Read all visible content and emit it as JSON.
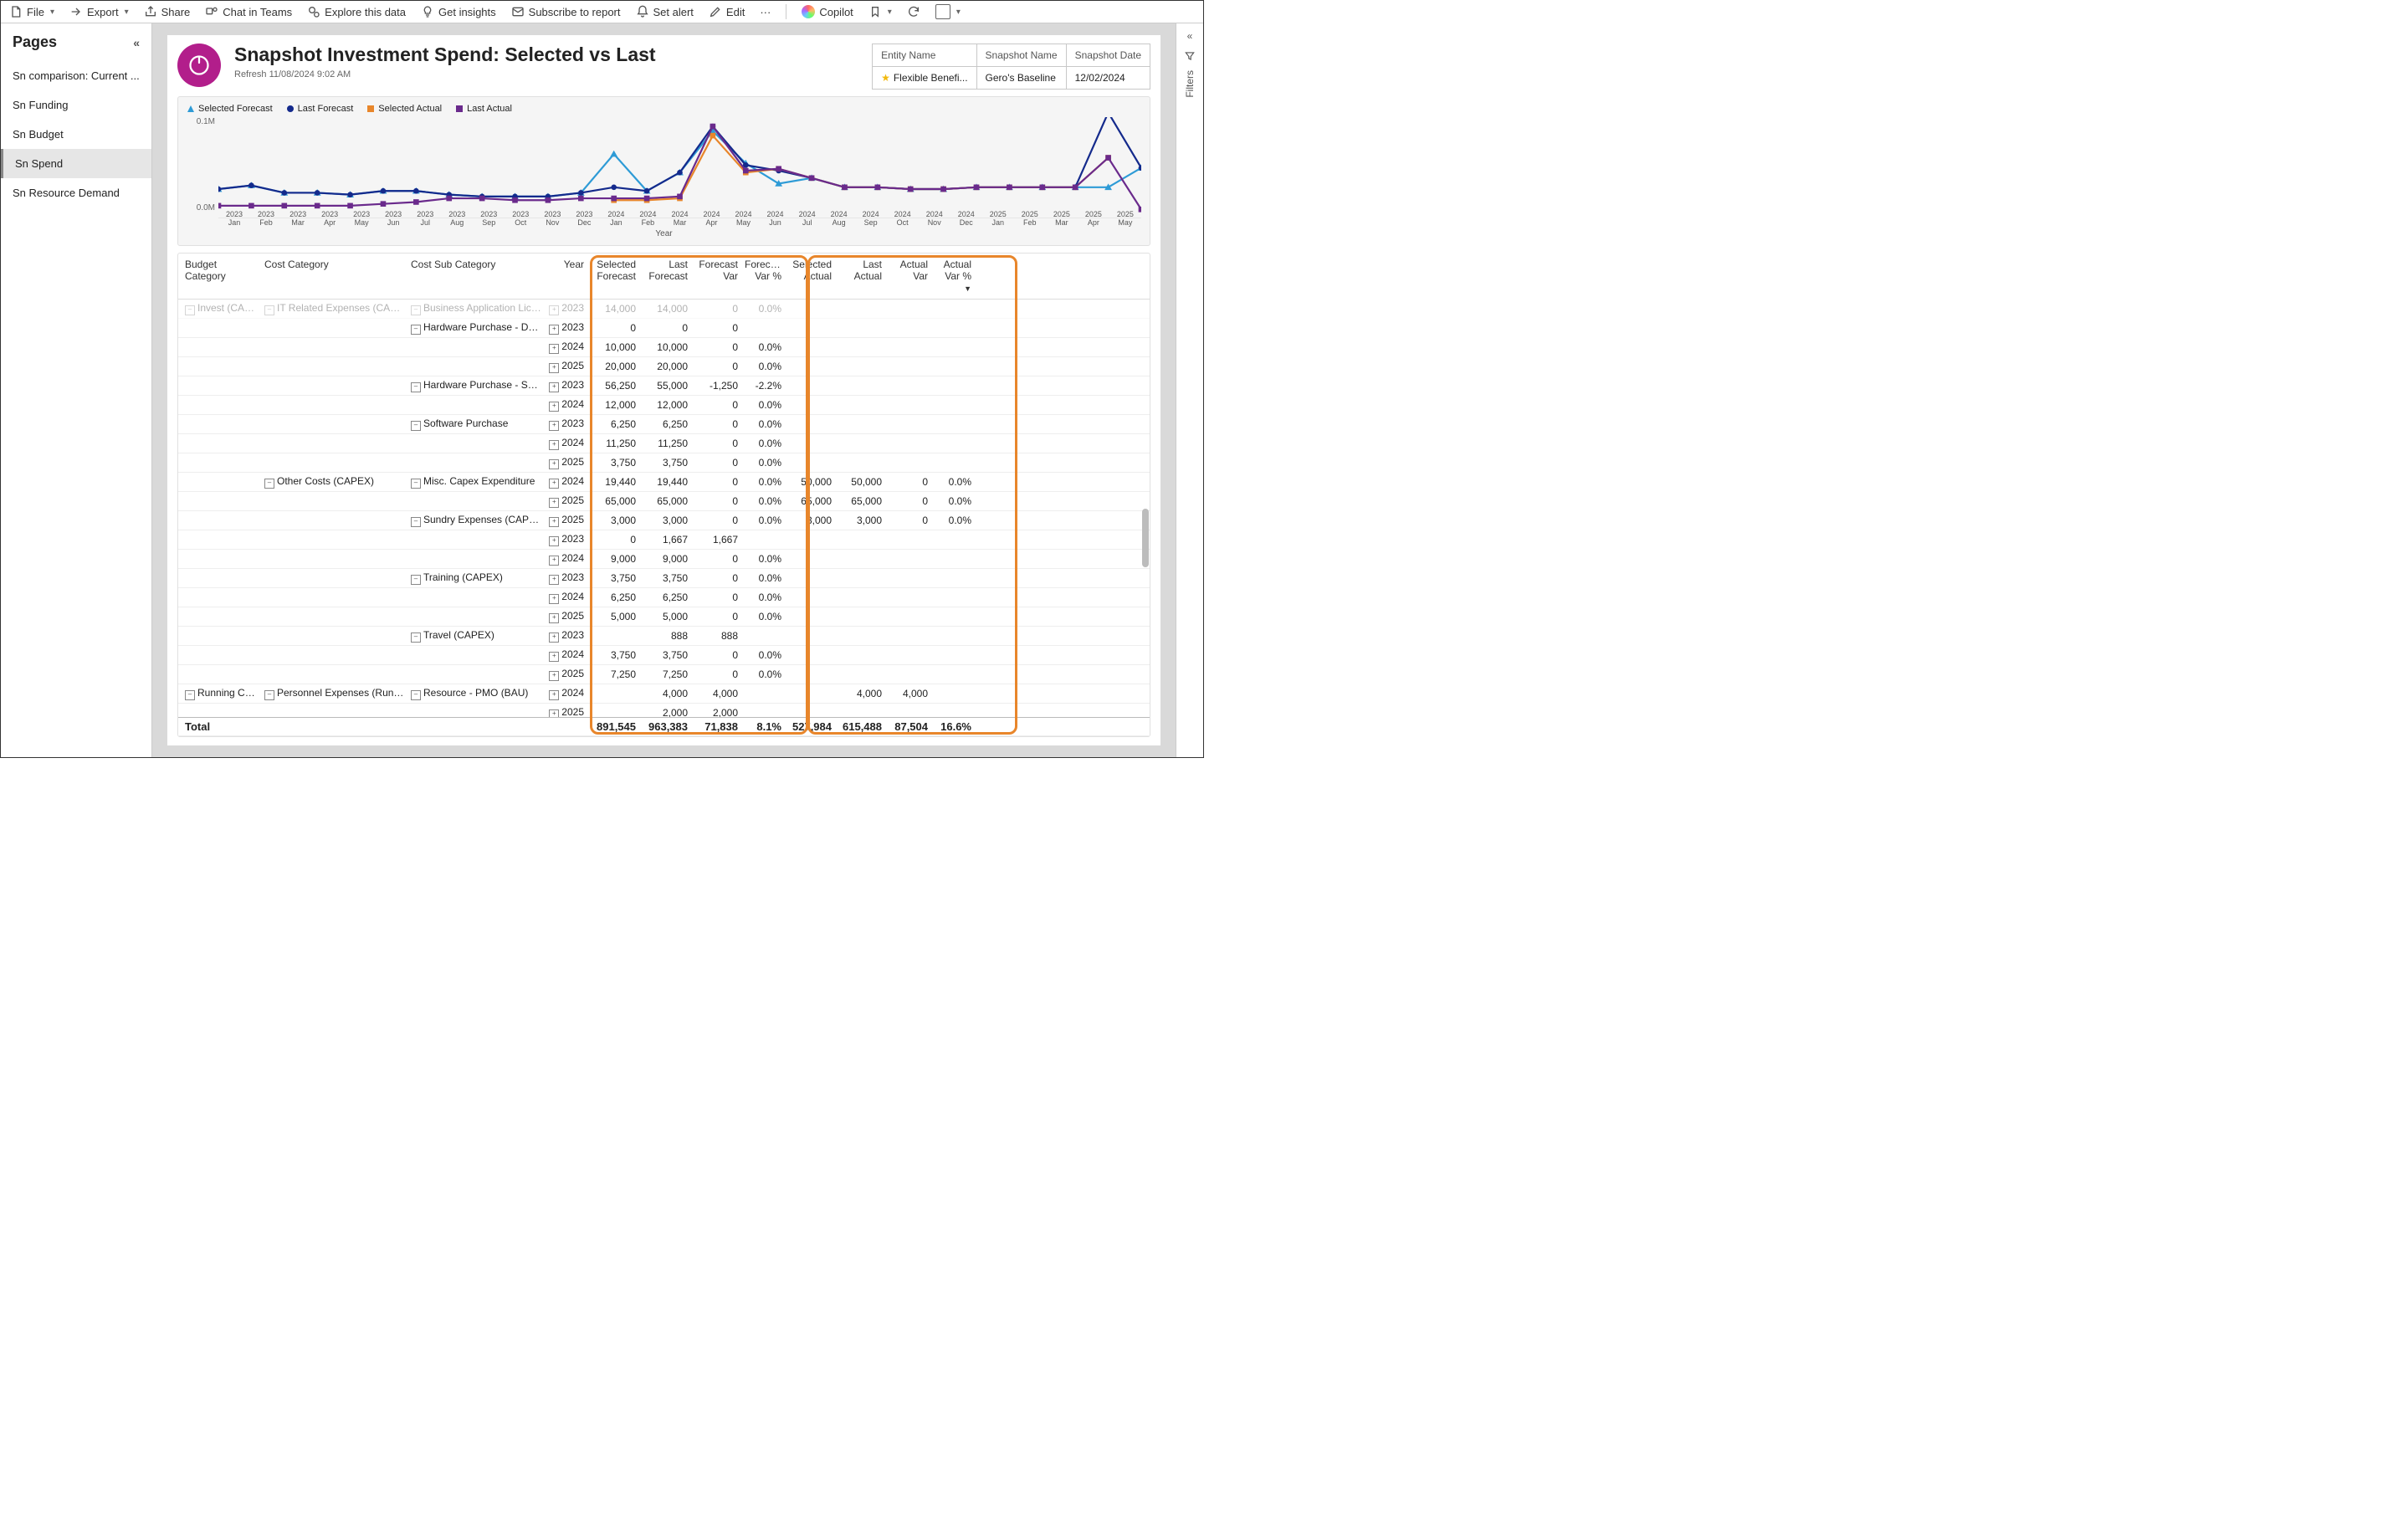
{
  "toolbar": {
    "file": "File",
    "export": "Export",
    "share": "Share",
    "chat": "Chat in Teams",
    "explore": "Explore this data",
    "insights": "Get insights",
    "subscribe": "Subscribe to report",
    "alert": "Set alert",
    "edit": "Edit",
    "more": "···",
    "copilot": "Copilot"
  },
  "sidebar": {
    "title": "Pages",
    "items": [
      "Sn comparison: Current ...",
      "Sn Funding",
      "Sn Budget",
      "Sn Spend",
      "Sn Resource Demand"
    ],
    "activeIndex": 3
  },
  "filters_rail": {
    "label": "Filters"
  },
  "header": {
    "title": "Snapshot Investment Spend: Selected vs Last",
    "refresh": "Refresh 11/08/2024 9:02 AM",
    "slicers": [
      {
        "head": "Entity Name",
        "value": "Flexible Benefi...",
        "star": true
      },
      {
        "head": "Snapshot Name",
        "value": "Gero's Baseline",
        "star": false
      },
      {
        "head": "Snapshot Date",
        "value": "12/02/2024",
        "star": false
      }
    ]
  },
  "chart": {
    "legend": [
      {
        "label": "Selected Forecast",
        "color": "#2e9bd6",
        "shape": "triangle"
      },
      {
        "label": "Last Forecast",
        "color": "#142a8c",
        "shape": "circle"
      },
      {
        "label": "Selected Actual",
        "color": "#e8862b",
        "shape": "square"
      },
      {
        "label": "Last Actual",
        "color": "#6a2a8c",
        "shape": "square"
      }
    ],
    "yticks": [
      "0.1M",
      "0.0M"
    ],
    "xlabel": "Year"
  },
  "chart_data": {
    "type": "line",
    "x": [
      "2023 Jan",
      "2023 Feb",
      "2023 Mar",
      "2023 Apr",
      "2023 May",
      "2023 Jun",
      "2023 Jul",
      "2023 Aug",
      "2023 Sep",
      "2023 Oct",
      "2023 Nov",
      "2023 Dec",
      "2024 Jan",
      "2024 Feb",
      "2024 Mar",
      "2024 Apr",
      "2024 May",
      "2024 Jun",
      "2024 Jul",
      "2024 Aug",
      "2024 Sep",
      "2024 Oct",
      "2024 Nov",
      "2024 Dec",
      "2025 Jan",
      "2025 Feb",
      "2025 Mar",
      "2025 Apr",
      "2025 May"
    ],
    "ylim": [
      0,
      110000
    ],
    "ylabel": "",
    "xlabel": "Year",
    "series": [
      {
        "name": "Selected Forecast",
        "color": "#2e9bd6",
        "values": [
          32000,
          36000,
          28000,
          28000,
          26000,
          30000,
          30000,
          26000,
          24000,
          24000,
          24000,
          28000,
          70000,
          30000,
          50000,
          95000,
          60000,
          38000,
          44000,
          34000,
          34000,
          32000,
          32000,
          34000,
          34000,
          34000,
          34000,
          34000,
          55000
        ]
      },
      {
        "name": "Last Forecast",
        "color": "#142a8c",
        "values": [
          32000,
          36000,
          28000,
          28000,
          26000,
          30000,
          30000,
          26000,
          24000,
          24000,
          24000,
          28000,
          34000,
          30000,
          50000,
          100000,
          58000,
          52000,
          44000,
          34000,
          34000,
          32000,
          32000,
          34000,
          34000,
          34000,
          34000,
          115000,
          55000
        ]
      },
      {
        "name": "Selected Actual",
        "color": "#e8862b",
        "values": [
          null,
          null,
          null,
          null,
          null,
          null,
          null,
          null,
          null,
          null,
          null,
          null,
          20000,
          20000,
          22000,
          90000,
          50000,
          54000,
          44000,
          34000,
          34000,
          32000,
          32000,
          34000,
          34000,
          34000,
          34000,
          66000,
          null
        ]
      },
      {
        "name": "Last Actual",
        "color": "#6a2a8c",
        "values": [
          14000,
          14000,
          14000,
          14000,
          14000,
          16000,
          18000,
          22000,
          22000,
          20000,
          20000,
          22000,
          22000,
          22000,
          24000,
          100000,
          52000,
          54000,
          44000,
          34000,
          34000,
          32000,
          32000,
          34000,
          34000,
          34000,
          34000,
          66000,
          10000
        ]
      }
    ]
  },
  "table": {
    "columns": [
      "Budget Category",
      "Cost Category",
      "Cost Sub Category",
      "Year",
      "Selected Forecast",
      "Last Forecast",
      "Forecast Var",
      "Forecast Var %",
      "Selected Actual",
      "Last Actual",
      "Actual Var",
      "Actual Var %"
    ],
    "rows": [
      {
        "bc": "Invest (CAPEX)",
        "cc": "IT Related Expenses (CAPEX)",
        "csc": "Business Application Licenses",
        "yr": "2023",
        "sf": "14,000",
        "lf": "14,000",
        "fv": "0",
        "fvp": "0.0%",
        "faded": true
      },
      {
        "csc": "Hardware Purchase - Devices",
        "yr": "2023",
        "sf": "0",
        "lf": "0",
        "fv": "0"
      },
      {
        "yr": "2024",
        "sf": "10,000",
        "lf": "10,000",
        "fv": "0",
        "fvp": "0.0%"
      },
      {
        "yr": "2025",
        "sf": "20,000",
        "lf": "20,000",
        "fv": "0",
        "fvp": "0.0%"
      },
      {
        "csc": "Hardware Purchase - Servers",
        "yr": "2023",
        "sf": "56,250",
        "lf": "55,000",
        "fv": "-1,250",
        "fvp": "-2.2%"
      },
      {
        "yr": "2024",
        "sf": "12,000",
        "lf": "12,000",
        "fv": "0",
        "fvp": "0.0%"
      },
      {
        "csc": "Software Purchase",
        "yr": "2023",
        "sf": "6,250",
        "lf": "6,250",
        "fv": "0",
        "fvp": "0.0%"
      },
      {
        "yr": "2024",
        "sf": "11,250",
        "lf": "11,250",
        "fv": "0",
        "fvp": "0.0%"
      },
      {
        "yr": "2025",
        "sf": "3,750",
        "lf": "3,750",
        "fv": "0",
        "fvp": "0.0%"
      },
      {
        "cc": "Other Costs (CAPEX)",
        "csc": "Misc. Capex Expenditure",
        "yr": "2024",
        "sf": "19,440",
        "lf": "19,440",
        "fv": "0",
        "fvp": "0.0%",
        "sa": "50,000",
        "la": "50,000",
        "av": "0",
        "avp": "0.0%"
      },
      {
        "yr": "2025",
        "sf": "65,000",
        "lf": "65,000",
        "fv": "0",
        "fvp": "0.0%",
        "sa": "65,000",
        "la": "65,000",
        "av": "0",
        "avp": "0.0%"
      },
      {
        "csc": "Sundry Expenses (CAPEX)",
        "yr": "2025",
        "sf": "3,000",
        "lf": "3,000",
        "fv": "0",
        "fvp": "0.0%",
        "sa": "3,000",
        "la": "3,000",
        "av": "0",
        "avp": "0.0%"
      },
      {
        "yr": "2023",
        "sf": "0",
        "lf": "1,667",
        "fv": "1,667"
      },
      {
        "yr": "2024",
        "sf": "9,000",
        "lf": "9,000",
        "fv": "0",
        "fvp": "0.0%"
      },
      {
        "csc": "Training (CAPEX)",
        "yr": "2023",
        "sf": "3,750",
        "lf": "3,750",
        "fv": "0",
        "fvp": "0.0%"
      },
      {
        "yr": "2024",
        "sf": "6,250",
        "lf": "6,250",
        "fv": "0",
        "fvp": "0.0%"
      },
      {
        "yr": "2025",
        "sf": "5,000",
        "lf": "5,000",
        "fv": "0",
        "fvp": "0.0%"
      },
      {
        "csc": "Travel (CAPEX)",
        "yr": "2023",
        "lf": "888",
        "fv": "888"
      },
      {
        "yr": "2024",
        "sf": "3,750",
        "lf": "3,750",
        "fv": "0",
        "fvp": "0.0%"
      },
      {
        "yr": "2025",
        "sf": "7,250",
        "lf": "7,250",
        "fv": "0",
        "fvp": "0.0%"
      },
      {
        "bc": "Running Costs (OPEX)",
        "cc": "Personnel Expenses (Running Costs OPEX)",
        "csc": "Resource - PMO (BAU)",
        "yr": "2024",
        "lf": "4,000",
        "fv": "4,000",
        "la": "4,000",
        "av": "4,000"
      },
      {
        "yr": "2025",
        "lf": "2,000",
        "fv": "2,000"
      }
    ],
    "total": {
      "label": "Total",
      "sf": "891,545",
      "lf": "963,383",
      "fv": "71,838",
      "fvp": "8.1%",
      "sa": "527,984",
      "la": "615,488",
      "av": "87,504",
      "avp": "16.6%"
    }
  }
}
